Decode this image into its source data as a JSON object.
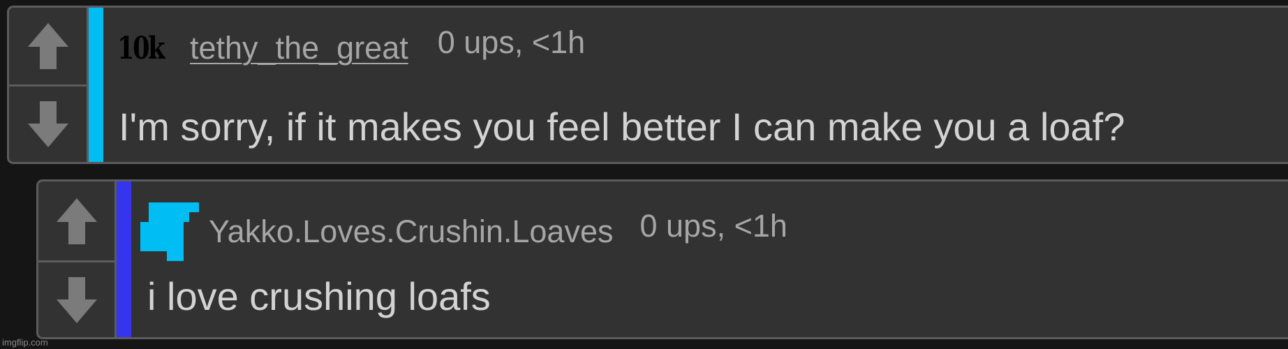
{
  "comments": [
    {
      "badge": "10k",
      "username": "tethy_the_great",
      "meta": "0 ups, <1h",
      "text": "I'm sorry, if it makes you feel better I can make you a loaf?",
      "depth_color": "#00bdf4",
      "upvote_icon": "arrow-up-icon",
      "downvote_icon": "arrow-down-icon"
    },
    {
      "avatar_icon": "pixel-avatar-icon",
      "avatar_color": "#00bdf4",
      "username": "Yakko.Loves.Crushin.Loaves",
      "meta": "0 ups, <1h",
      "text": "i love crushing loafs",
      "depth_color": "#3535f0",
      "upvote_icon": "arrow-up-icon",
      "downvote_icon": "arrow-down-icon"
    }
  ],
  "watermark": "imgflip.com",
  "colors": {
    "background": "#151515",
    "panel": "#323232",
    "border": "#5c5c5c",
    "vote_arrow": "#7b7b7b",
    "meta_text": "#a6a6a6",
    "body_text": "#d3d3d3"
  }
}
